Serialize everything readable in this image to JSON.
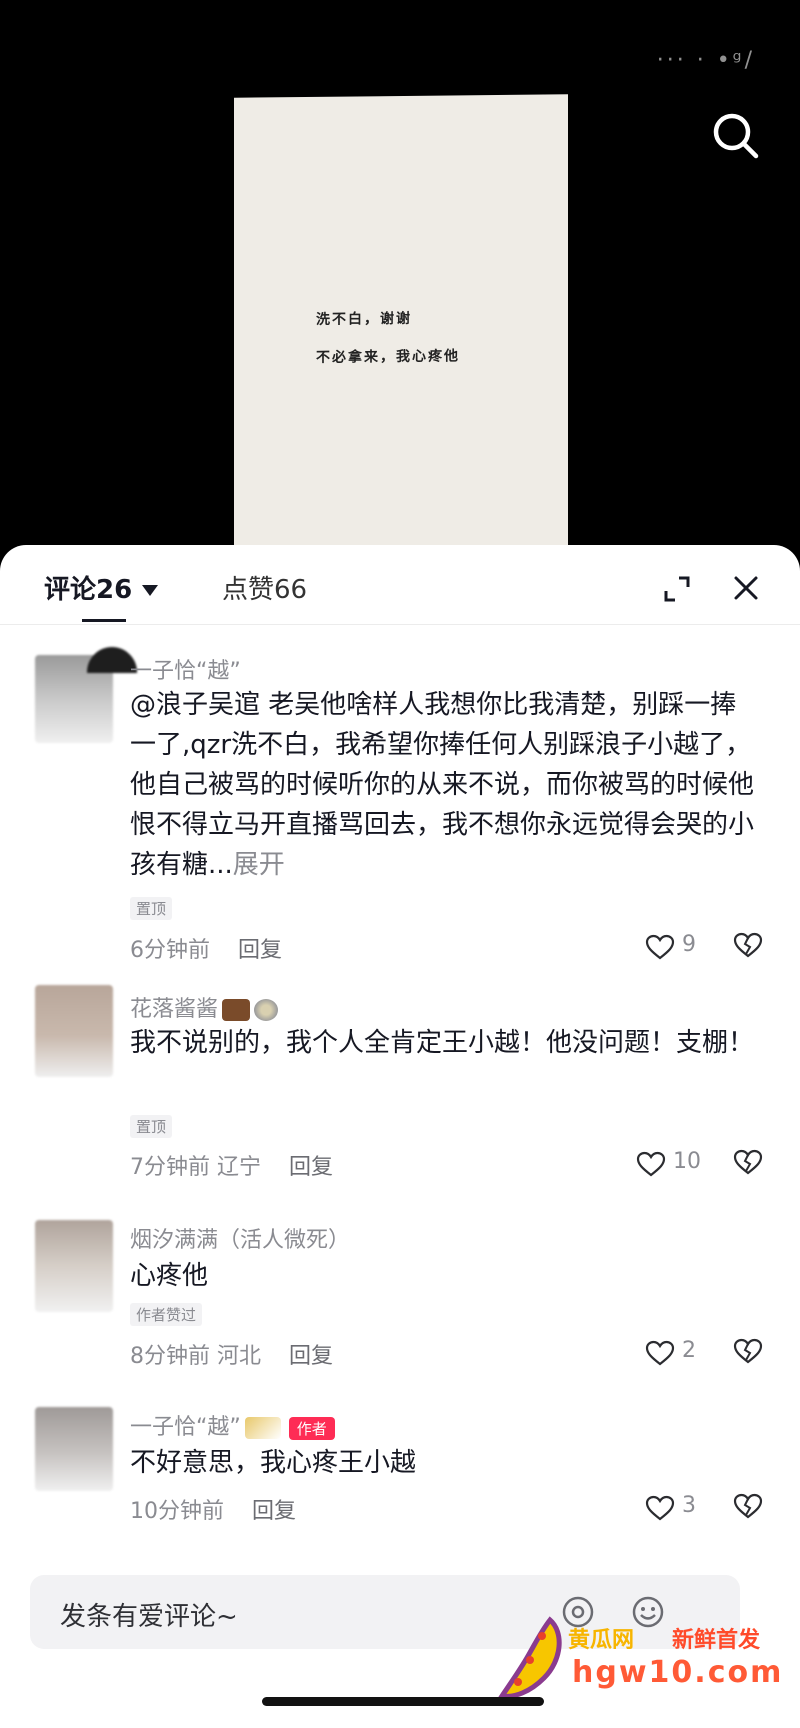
{
  "video": {
    "status_text": "···  ·  •ᵍ/",
    "note_line1": "洗不白，谢谢",
    "note_line2": "不必拿来，我心疼他"
  },
  "sheet": {
    "comments_tab": "评论26",
    "likes_tab": "点赞66"
  },
  "comments": [
    {
      "user": "一子恰“越”",
      "mention": "@浪子吴逭",
      "text": " 老吴他啥样人我想你比我清楚，别踩一捧一了,qzr洗不白，我希望你捧任何人别踩浪子小越了，他自己被骂的时候听你的从来不说，而你被骂的时候他恨不得立马开直播骂回去，我不想你永远觉得会哭的小孩有糖...",
      "more": "展开",
      "tag": "置顶",
      "time": "6分钟前",
      "reply": "回复",
      "likes": "9"
    },
    {
      "user": "花落酱酱",
      "text": "我不说别的，我个人全肯定王小越！他没问题！支棚！",
      "tag": "置顶",
      "time": "7分钟前 辽宁",
      "reply": "回复",
      "likes": "10"
    },
    {
      "user": "烟汐满满（活人微死）",
      "text": "心疼他",
      "tag": "作者赞过",
      "time": "8分钟前 河北",
      "reply": "回复",
      "likes": "2"
    },
    {
      "user": "一子恰“越”",
      "badge": "作者",
      "text": "不好意思，我心疼王小越",
      "time": "10分钟前",
      "reply": "回复",
      "likes": "3"
    }
  ],
  "input": {
    "placeholder": "发条有爱评论~"
  },
  "watermark": {
    "name": "黄瓜网",
    "slogan": "新鲜首发",
    "url": "hgw10.com"
  },
  "colors": {
    "accent": "#fe2c55",
    "text": "#161823",
    "muted": "#8a8b91"
  }
}
